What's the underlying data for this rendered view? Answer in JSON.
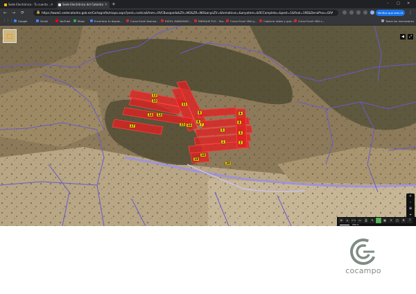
{
  "browser": {
    "tabs": [
      {
        "title": "Sede Electrónica - Tu cuenta ...",
        "active": false
      },
      {
        "title": "Sede Electrónica del Catastro",
        "active": true
      }
    ],
    "new_tab_glyph": "+",
    "window_controls": [
      "–",
      "□",
      "✕"
    ],
    "nav_glyphs": {
      "back": "←",
      "forward": "→",
      "reload": "⟳"
    },
    "url": "https://www1.sedecatastro.gob.es/Cartografia/mapa.aspx?pest=rustica&from=OVCBusqueda&ZV=NO&ZR=NO&anyoZV=&tematicos=&anyotem=&RCCompleta=&pest=1&final=1RE&DenoProv=GRANADA&prov=18...",
    "verify_button": "Verifica que eres tú",
    "menu_glyph": "⋮",
    "apps_glyph": "⋮⋮⋮",
    "bookmarks": [
      {
        "label": "Google",
        "icon": "g"
      },
      {
        "label": "Gmail",
        "icon": "g"
      },
      {
        "label": "YouTube",
        "icon": "yt"
      },
      {
        "label": "Maps",
        "icon": "m"
      },
      {
        "label": "Encontrar tu dispos...",
        "icon": "g"
      },
      {
        "label": "Curso Excel Avanza...",
        "icon": "d"
      },
      {
        "label": "EXCEL AVANZADO...",
        "icon": "d"
      },
      {
        "label": "ENRIQUE PLG - You...",
        "icon": "d"
      },
      {
        "label": "Curso Excel VBA g...",
        "icon": "d"
      },
      {
        "label": "Capturar datos y gua...",
        "icon": "d"
      },
      {
        "label": "Curso Excel VBA x...",
        "icon": "d"
      }
    ],
    "all_bookmarks": "Todos los marcadores"
  },
  "map": {
    "parcel_labels": [
      "12",
      "10",
      "11",
      "8",
      "14",
      "13",
      "9",
      "7",
      "5",
      "6",
      "4",
      "3",
      "2",
      "1",
      "15",
      "16",
      "17",
      "18",
      "19",
      "20"
    ],
    "scale_label": "200 m",
    "tool_glyphs": [
      "⊞",
      "⌂",
      "⟷",
      "▭",
      "⎙",
      "✎",
      "⛶",
      "▦",
      "✕",
      "◳",
      "⚙",
      "?"
    ],
    "right_nav_glyphs": [
      "+",
      "–",
      "⊕",
      "⌖"
    ],
    "corner_controls": [
      "◀",
      "⤢"
    ],
    "colors": {
      "parcel_fill": "#e02020",
      "parcel_stroke": "#ff4040",
      "label_bg": "#ffd400",
      "boundary": "#6a5acd",
      "road": "#9b8ee8",
      "terrain": "#8c7a5a"
    }
  },
  "logo": {
    "text": "cocampo",
    "color": "#7f8c85"
  }
}
